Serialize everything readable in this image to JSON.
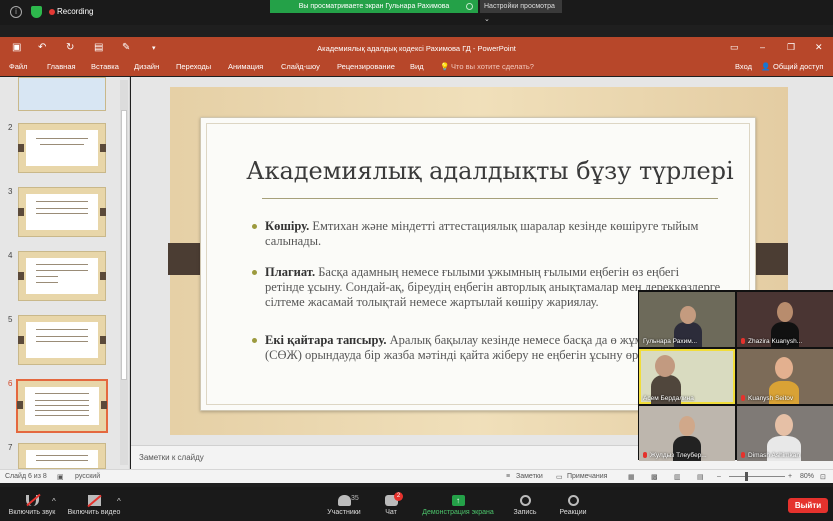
{
  "zoom_top": {
    "recording": "Recording",
    "sharing_banner": "Вы просматриваете экран Гульнара Рахимова",
    "view_options": "Настройки просмотра"
  },
  "ppt": {
    "window_title": "Академиялық адалдық кодексі Рахимова ГД - PowerPoint",
    "tabs": [
      "Файл",
      "Главная",
      "Вставка",
      "Дизайн",
      "Переходы",
      "Анимация",
      "Слайд-шоу",
      "Рецензирование",
      "Вид"
    ],
    "tell_me": "Что вы хотите сделать?",
    "sign_in": "Вход",
    "share": "Общий доступ",
    "thumbnail_numbers": [
      "2",
      "3",
      "4",
      "5",
      "6",
      "7"
    ],
    "slide": {
      "title": "Академиялық адалдықты бұзу түрлері",
      "bullets": [
        {
          "head": "Көшіру.",
          "text": "Емтихан және міндетті аттестациялық шаралар кезінде көшіруге тыйым салынады."
        },
        {
          "head": "Плагиат.",
          "text": "Басқа адамның немесе ғылыми ұжымның ғылыми еңбегін өз еңбегі ретінде ұсыну. Сондай-ақ, біреудің еңбегін авторлық анықтамалар мен дереккөздерге сілтеме жасамай толықтай немесе жартылай көшіру жариялау."
        },
        {
          "head": "Екі қайтара тапсыру.",
          "text": "Аралық бақылау кезінде немесе басқа да ө жұмыстарды (СӨЖ) орындауда бір жазба мәтінді қайта жіберу не еңбегін ұсыну өрескел қателік."
        }
      ]
    },
    "notes_placeholder": "Заметки к слайду",
    "status": {
      "slide_counter": "Слайд 6 из 8",
      "language": "русский",
      "notes_btn": "Заметки",
      "comments_btn": "Примечания",
      "zoom": "80%"
    }
  },
  "gallery": {
    "participants": [
      "Гульнара Рахим...",
      "Zhazira Kuanysh...",
      "Асем Бердалина",
      "Kuanysh Seitov",
      "Жулдыз Тлеубер...",
      "Dimash Ashimkan"
    ]
  },
  "zoom_bottom": {
    "mute": "Включить звук",
    "video": "Включить видео",
    "participants": "Участники",
    "participants_count": "35",
    "chat": "Чат",
    "chat_badge": "2",
    "share": "Демонстрация экрана",
    "record": "Запись",
    "reactions": "Реакции",
    "leave": "Выйти"
  },
  "colors": {
    "ppt_accent": "#b7472a",
    "zoom_green": "#24a148",
    "leave_red": "#e5322d"
  }
}
